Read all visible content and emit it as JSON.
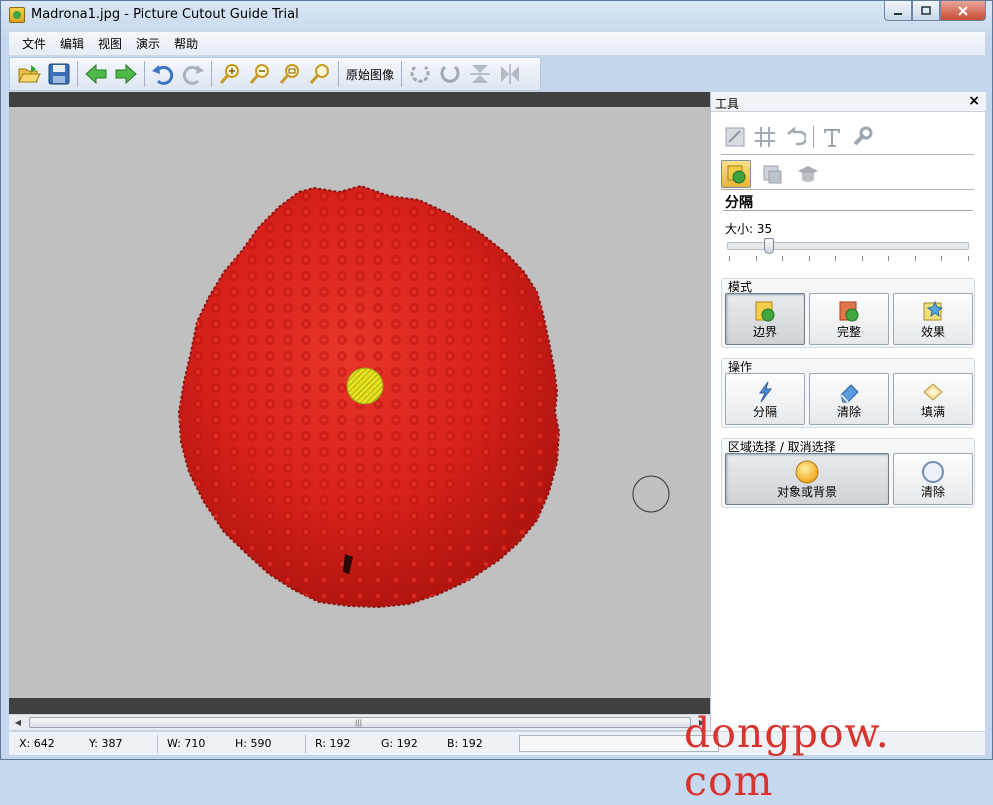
{
  "window": {
    "title": "Madrona1.jpg - Picture Cutout Guide Trial",
    "min_label": "▭",
    "max_label": "□",
    "close_label": "✕"
  },
  "menu": {
    "items": [
      "文件",
      "编辑",
      "视图",
      "演示",
      "帮助"
    ]
  },
  "toolbar": {
    "original_image_label": "原始图像",
    "icons": [
      "open-icon",
      "save-icon",
      "back-icon",
      "forward-icon",
      "undo-icon",
      "redo-icon",
      "zoom-in-icon",
      "zoom-out-icon",
      "zoom-fit-icon",
      "zoom-actual-icon",
      "rotate-left-icon",
      "rotate-right-icon",
      "flip-vertical-icon",
      "flip-horizontal-icon"
    ]
  },
  "canvas": {
    "background": "#c0c0c0",
    "fruit_color": "#d9201c",
    "marker_color": "#e6e21e"
  },
  "panel": {
    "title": "工具",
    "close": "×",
    "section_title": "分隔",
    "size_label": "大小: 35",
    "size_value": 35,
    "mode": {
      "label": "模式",
      "buttons": [
        "边界",
        "完整",
        "效果"
      ],
      "selected": "边界"
    },
    "operation": {
      "label": "操作",
      "buttons": [
        "分隔",
        "清除",
        "填满"
      ]
    },
    "region": {
      "label": "区域选择 / 取消选择",
      "buttons": [
        "对象或背景",
        "清除"
      ],
      "selected": "对象或背景"
    }
  },
  "status": {
    "x": "X: 642",
    "y": "Y: 387",
    "w": "W: 710",
    "h": "H: 590",
    "r": "R: 192",
    "g": "G: 192",
    "b": "B: 192"
  },
  "watermark": "dongpow. com"
}
